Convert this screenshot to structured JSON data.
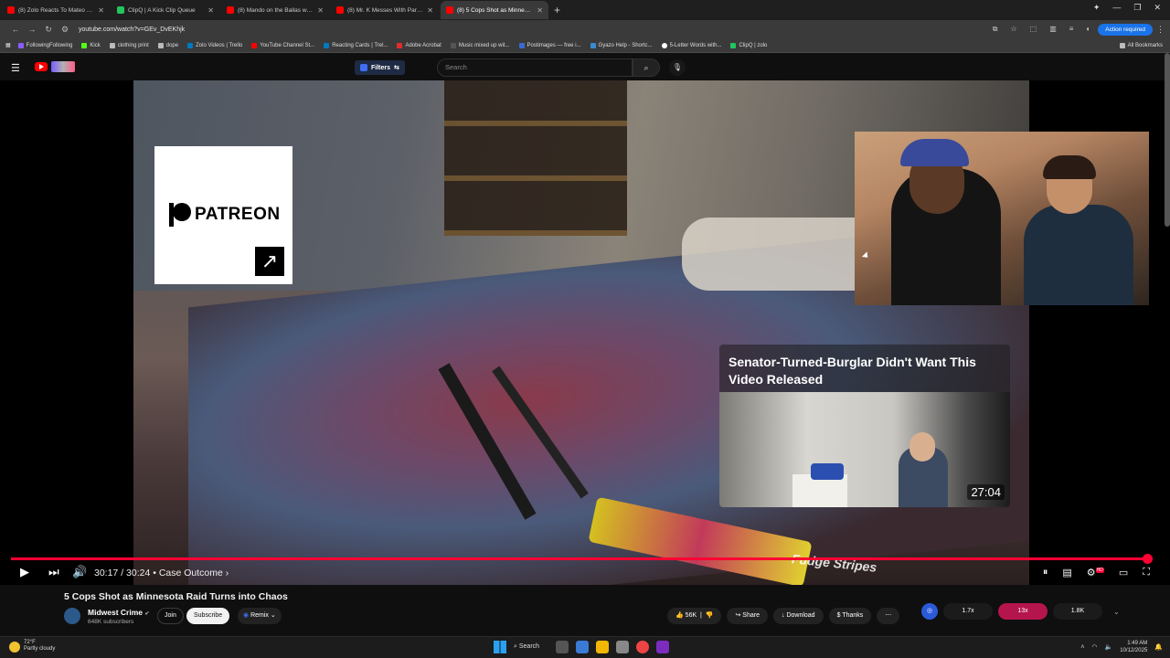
{
  "browser": {
    "tabs": [
      {
        "title": "(8) Zolo Reacts To Mateo Shooti",
        "color": "#ff0000",
        "active": false
      },
      {
        "title": "ClipQ | A Kick Clip Queue",
        "color": "#22c55e",
        "active": false
      },
      {
        "title": "(8) Mando on the Ballas withou",
        "color": "#ff0000",
        "active": false
      },
      {
        "title": "(8) Mr. K Messes With Paris in",
        "color": "#ff0000",
        "active": false
      },
      {
        "title": "(8) 5 Cops Shot as Minnesota",
        "color": "#ff0000",
        "active": true
      }
    ],
    "url": "youtube.com/watch?v=GEv_DvEKhjk",
    "action_required": "Action required",
    "bookmarks": [
      {
        "label": "FollowingFollowing",
        "color": "#8a5cff"
      },
      {
        "label": "Kick",
        "color": "#53fc18"
      },
      {
        "label": "clothing print",
        "color": "#bbbbbb"
      },
      {
        "label": "dope",
        "color": "#bbbbbb"
      },
      {
        "label": "Zolo Videos | Trello",
        "color": "#0079bf"
      },
      {
        "label": "YouTube Channel St...",
        "color": "#ff0000"
      },
      {
        "label": "Reacting Cards | Trel...",
        "color": "#0079bf"
      },
      {
        "label": "Adobe Acrobat",
        "color": "#e22b2b"
      },
      {
        "label": "Music mixed up wit...",
        "color": "#333333"
      },
      {
        "label": "Postimages — free i...",
        "color": "#3a6ad0"
      },
      {
        "label": "Gyazo Help - Shortc...",
        "color": "#3a8ad0"
      },
      {
        "label": "5-Letter Words with...",
        "color": "#ffffff"
      },
      {
        "label": "ClipQ | zolo",
        "color": "#22c55e"
      }
    ],
    "all_bookmarks": "All Bookmarks"
  },
  "youtube": {
    "filters_label": "Filters",
    "search_placeholder": "Search",
    "patreon_label": "PATREON",
    "suggestion_title": "Senator-Turned-Burglar Didn't Want This Video Released",
    "suggestion_duration": "27:04",
    "scene_caption": "Fudge Stripes",
    "progress": 0.996,
    "time": "30:17 / 30:24 • Case Outcome ›",
    "video_title": "5 Cops Shot as Minnesota Raid Turns into Chaos",
    "channel_name": "Midwest Crime",
    "channel_subs": "648K subscribers",
    "join_label": "Join",
    "subscribe_label": "Subscribe",
    "remix_label": "Remix",
    "likes": "56K",
    "share_label": "Share",
    "download_label": "Download",
    "thanks_label": "Thanks",
    "ext_stats": [
      "1.7x",
      "13x",
      "1.8K"
    ],
    "hd_badge": "HD"
  },
  "taskbar": {
    "temp": "72°F",
    "weather": "Partly cloudy",
    "search": "Search",
    "time": "1:49 AM",
    "date": "10/12/2025"
  }
}
